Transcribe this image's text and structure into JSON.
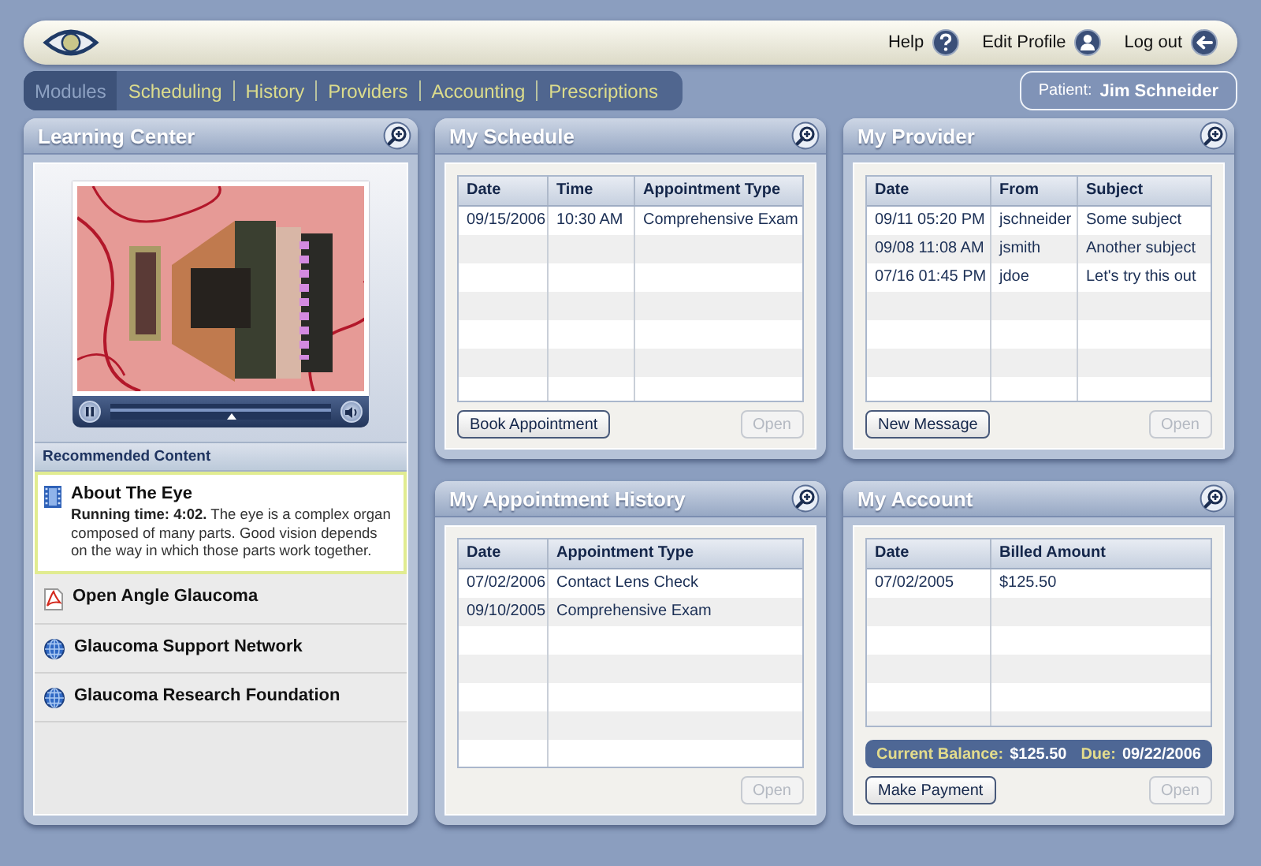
{
  "header": {
    "links": [
      {
        "kind": "help",
        "label": "Help"
      },
      {
        "kind": "profile",
        "label": "Edit Profile"
      },
      {
        "kind": "logout",
        "label": "Log out"
      }
    ]
  },
  "nav": {
    "tabs": [
      {
        "label": "Modules",
        "selected": true
      },
      {
        "label": "Scheduling",
        "selected": false
      },
      {
        "label": "History",
        "selected": false
      },
      {
        "label": "Providers",
        "selected": false
      },
      {
        "label": "Accounting",
        "selected": false
      },
      {
        "label": "Prescriptions",
        "selected": false
      }
    ]
  },
  "patient": {
    "label": "Patient:",
    "name": "Jim Schneider"
  },
  "learning_center": {
    "title": "Learning Center",
    "video": {
      "kind": "picture",
      "playing": true,
      "level": 0.55
    },
    "recommended_heading": "Recommended Content",
    "items": [
      {
        "kind": "video",
        "title": "About The Eye",
        "selected": true,
        "description": "**Running time: 4:02.** The eye is a complex organ composed of many parts. Good vision depends on the way in which those parts work together."
      },
      {
        "kind": "pdf",
        "title": "Open Angle Glaucoma",
        "selected": false
      },
      {
        "kind": "web",
        "title": "Glaucoma Support Network",
        "selected": false
      },
      {
        "kind": "web",
        "title": "Glaucoma Research Foundation",
        "selected": false
      }
    ]
  },
  "panels": [
    {
      "title": "My Schedule",
      "columns": [
        "Date",
        "Time",
        "Appointment Type"
      ],
      "rows": [
        [
          "09/15/2006",
          "10:30 AM",
          "Comprehensive Exam"
        ]
      ],
      "buttons": [
        {
          "label": "Book Appointment",
          "disabled": false
        },
        {
          "label": "Open",
          "disabled": true
        }
      ]
    },
    {
      "title": "My Provider",
      "columns": [
        "Date",
        "From",
        "Subject"
      ],
      "rows": [
        [
          "09/11 05:20 PM",
          "jschneider",
          "Some subject"
        ],
        [
          "09/08 11:08 AM",
          "jsmith",
          "Another subject"
        ],
        [
          "07/16 01:45 PM",
          "jdoe",
          "Let's try this out"
        ]
      ],
      "buttons": [
        {
          "label": "New Message",
          "disabled": false
        },
        {
          "label": "Open",
          "disabled": true
        }
      ]
    },
    {
      "title": "My Appointment History",
      "columns": [
        "Date",
        "Appointment Type"
      ],
      "rows": [
        [
          "07/02/2006",
          "Contact Lens Check"
        ],
        [
          "09/10/2005",
          "Comprehensive Exam"
        ]
      ],
      "buttons": [
        {
          "label": "Open",
          "disabled": true
        }
      ]
    },
    {
      "title": "My Account",
      "columns": [
        "Date",
        "Billed Amount"
      ],
      "rows": [
        [
          "07/02/2005",
          "$125.50"
        ]
      ],
      "balance": {
        "balance_label": "Current Balance:",
        "balance": "$125.50",
        "due_label": "Due:",
        "due": "09/22/2006"
      },
      "buttons": [
        {
          "label": "Make Payment",
          "disabled": false
        },
        {
          "label": "Open",
          "disabled": true
        }
      ]
    }
  ]
}
